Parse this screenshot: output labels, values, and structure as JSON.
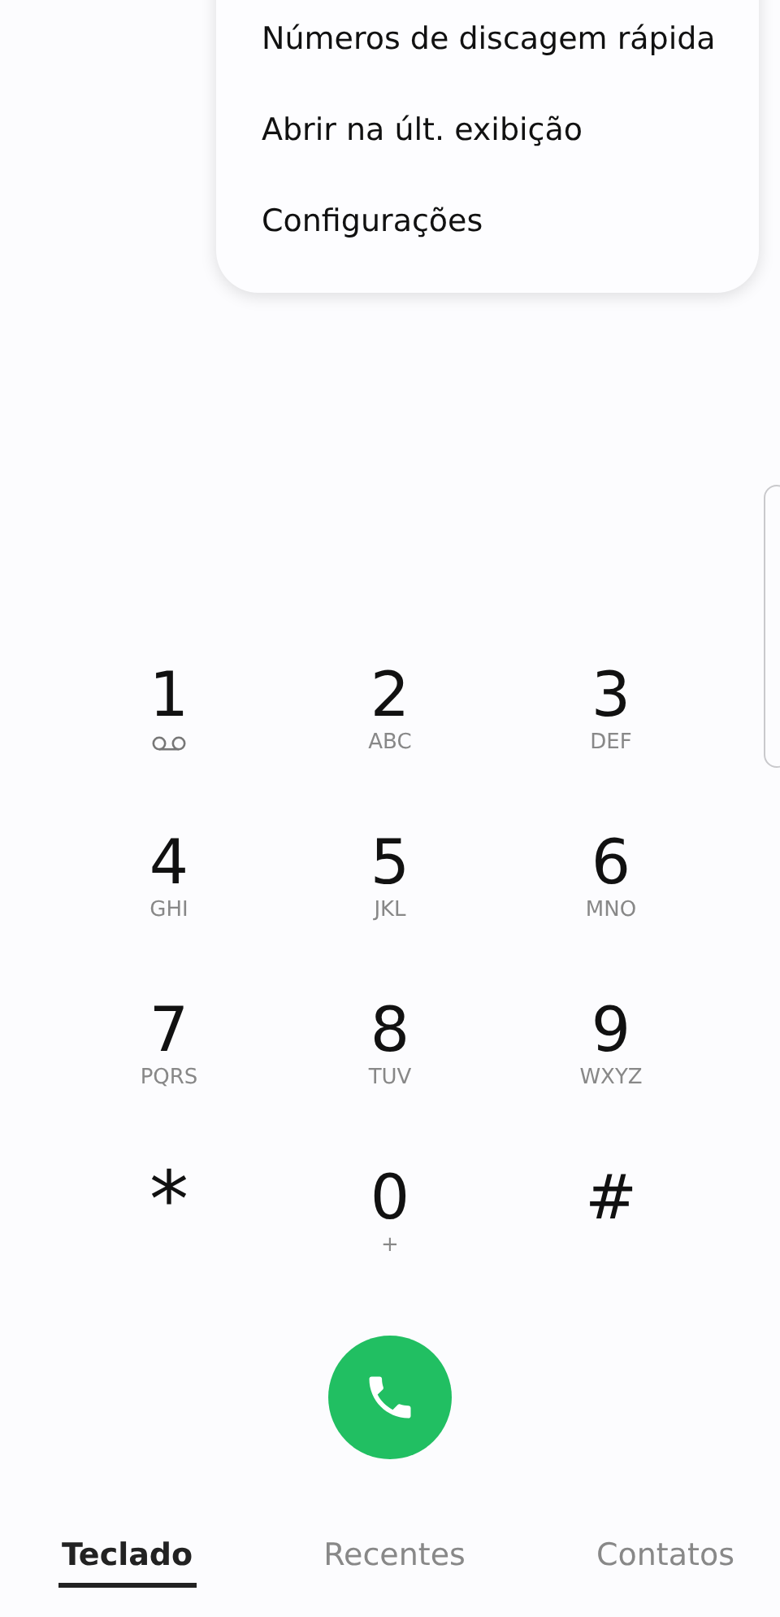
{
  "menu": {
    "items": [
      "Números de discagem rápida",
      "Abrir na últ. exibição",
      "Configurações"
    ]
  },
  "keypad": [
    {
      "digit": "1",
      "kind": "voicemail"
    },
    {
      "digit": "2",
      "kind": "letters",
      "letters": "ABC"
    },
    {
      "digit": "3",
      "kind": "letters",
      "letters": "DEF"
    },
    {
      "digit": "4",
      "kind": "letters",
      "letters": "GHI"
    },
    {
      "digit": "5",
      "kind": "letters",
      "letters": "JKL"
    },
    {
      "digit": "6",
      "kind": "letters",
      "letters": "MNO"
    },
    {
      "digit": "7",
      "kind": "letters",
      "letters": "PQRS"
    },
    {
      "digit": "8",
      "kind": "letters",
      "letters": "TUV"
    },
    {
      "digit": "9",
      "kind": "letters",
      "letters": "WXYZ"
    },
    {
      "digit": "*",
      "kind": "star"
    },
    {
      "digit": "0",
      "kind": "letters",
      "letters": "+"
    },
    {
      "digit": "#",
      "kind": "plain"
    }
  ],
  "tabs": [
    {
      "label": "Teclado",
      "selected": true
    },
    {
      "label": "Recentes",
      "selected": false
    },
    {
      "label": "Contatos",
      "selected": false
    }
  ]
}
